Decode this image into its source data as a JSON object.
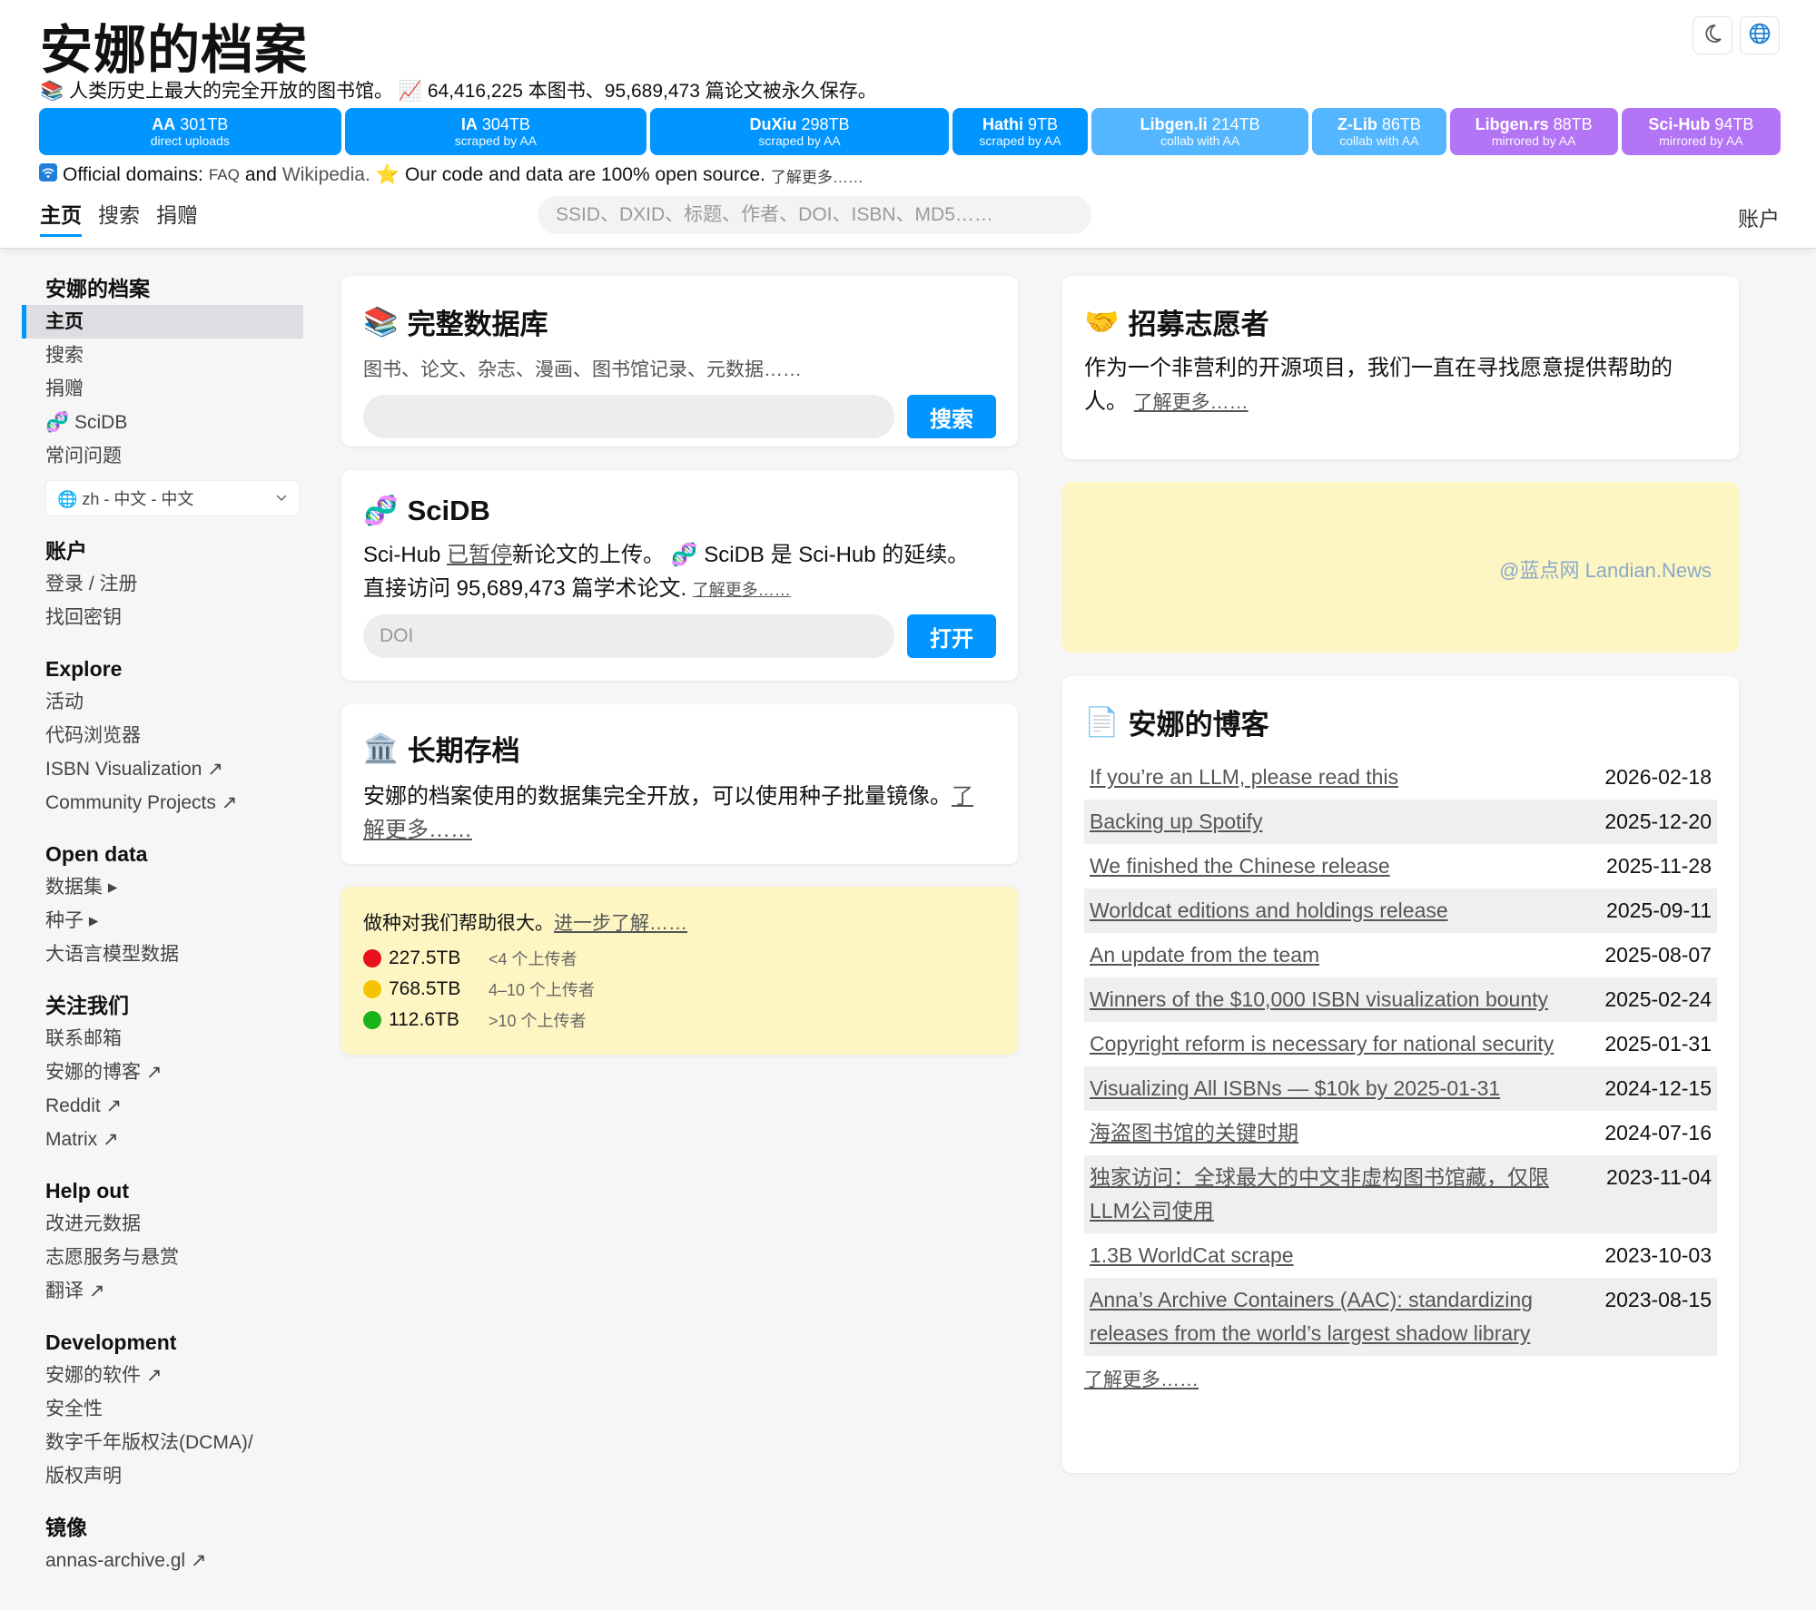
{
  "header": {
    "title": "安娜的档案",
    "tagline_part1": "人类历史上最大的完全开放的图书馆。",
    "tagline_part2": "64,416,225 本图书、95,689,473 篇论文被永久保存。",
    "stats": [
      {
        "name": "AA",
        "size": "301TB",
        "sub": "direct uploads",
        "color": "#0095ff",
        "flex": 334
      },
      {
        "name": "IA",
        "size": "304TB",
        "sub": "scraped by AA",
        "color": "#0095ff",
        "flex": 334
      },
      {
        "name": "DuXiu",
        "size": "298TB",
        "sub": "scraped by AA",
        "color": "#0095ff",
        "flex": 330
      },
      {
        "name": "Hathi",
        "size": "9TB",
        "sub": "scraped by AA",
        "color": "#0095ff",
        "flex": 150
      },
      {
        "name": "Libgen.li",
        "size": "214TB",
        "sub": "collab with AA",
        "color": "#54b6ff",
        "flex": 240
      },
      {
        "name": "Z-Lib",
        "size": "86TB",
        "sub": "collab with AA",
        "color": "#54b6ff",
        "flex": 148
      },
      {
        "name": "Libgen.rs",
        "size": "88TB",
        "sub": "mirrored by AA",
        "color": "#b374f5",
        "flex": 186
      },
      {
        "name": "Sci-Hub",
        "size": "94TB",
        "sub": "mirrored by AA",
        "color": "#b374f5",
        "flex": 176
      }
    ],
    "domains_prefix": "Official domains:",
    "domains_faq": "FAQ",
    "domains_and": "and",
    "domains_wiki": "Wikipedia.",
    "open_source": "Our code and data are 100% open source.",
    "learn_more": "了解更多……",
    "nav": [
      "主页",
      "搜索",
      "捐赠"
    ],
    "search_placeholder": "SSID、DXID、标题、作者、DOI、ISBN、MD5……",
    "account": "账户"
  },
  "sidebar": {
    "sections": [
      {
        "heading": "安娜的档案",
        "items": [
          {
            "label": "主页",
            "active": true
          },
          {
            "label": "搜索"
          },
          {
            "label": "捐赠"
          },
          {
            "label": "🧬 SciDB"
          },
          {
            "label": "常问问题"
          }
        ],
        "lang": "🌐 zh - 中文 - 中文"
      },
      {
        "heading": "账户",
        "items": [
          {
            "label": "登录 / 注册"
          },
          {
            "label": "找回密钥"
          }
        ]
      },
      {
        "heading": "Explore",
        "items": [
          {
            "label": "活动"
          },
          {
            "label": "代码浏览器"
          },
          {
            "label": "ISBN Visualization ↗"
          },
          {
            "label": "Community Projects ↗"
          }
        ]
      },
      {
        "heading": "Open data",
        "items": [
          {
            "label": "数据集 ▸"
          },
          {
            "label": "种子 ▸"
          },
          {
            "label": "大语言模型数据"
          }
        ]
      },
      {
        "heading": "关注我们",
        "items": [
          {
            "label": "联系邮箱"
          },
          {
            "label": "安娜的博客 ↗"
          },
          {
            "label": "Reddit ↗"
          },
          {
            "label": "Matrix ↗"
          }
        ]
      },
      {
        "heading": "Help out",
        "items": [
          {
            "label": "改进元数据"
          },
          {
            "label": "志愿服务与悬赏"
          },
          {
            "label": "翻译 ↗"
          }
        ]
      },
      {
        "heading": "Development",
        "items": [
          {
            "label": "安娜的软件 ↗"
          },
          {
            "label": "安全性"
          },
          {
            "label": "数字千年版权法(DCMA)/"
          },
          {
            "label": "版权声明"
          }
        ]
      },
      {
        "heading": "镜像",
        "items": [
          {
            "label": "annas-archive.gl ↗"
          }
        ]
      }
    ]
  },
  "cards": {
    "database": {
      "title": "完整数据库",
      "subtitle": "图书、论文、杂志、漫画、图书馆记录、元数据……",
      "button": "搜索"
    },
    "scidb": {
      "title": "SciDB",
      "text1a": "Sci-Hub",
      "text1_link": "已暂停",
      "text1b": "新论文的上传。 🧬 SciDB 是 Sci-Hub 的延续。",
      "text2": "直接访问 95,689,473 篇学术论文.",
      "learn_more": "了解更多……",
      "placeholder": "DOI",
      "button": "打开"
    },
    "archive": {
      "title": "长期存档",
      "text": "安娜的档案使用的数据集完全开放，可以使用种子批量镜像。",
      "link_a": "了",
      "link_b": "解更多……"
    },
    "seeding": {
      "intro": "做种对我们帮助很大。",
      "link": "进一步了解……",
      "rows": [
        {
          "value": "227.5TB",
          "note": "<4 个上传者",
          "color": "#e8131a"
        },
        {
          "value": "768.5TB",
          "note": "4–10 个上传者",
          "color": "#f5c400"
        },
        {
          "value": "112.6TB",
          "note": ">10 个上传者",
          "color": "#1bb31b"
        }
      ]
    },
    "volunteer": {
      "title": "招募志愿者",
      "text": "作为一个非营利的开源项目，我们一直在寻找愿意提供帮助的",
      "text2": "人。",
      "link": "了解更多……"
    },
    "watermark": "@蓝点网 Landian.News",
    "blog": {
      "title": "安娜的博客",
      "posts": [
        {
          "title": "If you’re an LLM, please read this",
          "date": "2026-02-18"
        },
        {
          "title": "Backing up Spotify",
          "date": "2025-12-20"
        },
        {
          "title": "We finished the Chinese release",
          "date": "2025-11-28"
        },
        {
          "title": "Worldcat editions and holdings release",
          "date": "2025-09-11"
        },
        {
          "title": "An update from the team",
          "date": "2025-08-07"
        },
        {
          "title": "Winners of the $10,000 ISBN visualization bounty",
          "date": "2025-02-24"
        },
        {
          "title": "Copyright reform is necessary for national security",
          "date": "2025-01-31"
        },
        {
          "title": "Visualizing All ISBNs — $10k by 2025-01-31",
          "date": "2024-12-15"
        },
        {
          "title": "海盗图书馆的关键时期",
          "date": "2024-07-16"
        },
        {
          "title": "独家访问：全球最大的中文非虚构图书馆藏，仅限LLM公司使用",
          "date": "2023-11-04"
        },
        {
          "title": "1.3B WorldCat scrape",
          "date": "2023-10-03"
        },
        {
          "title": "Anna’s Archive Containers (AAC): standardizing releases from the world’s largest shadow library",
          "date": "2023-08-15"
        }
      ],
      "more": "了解更多……"
    }
  }
}
